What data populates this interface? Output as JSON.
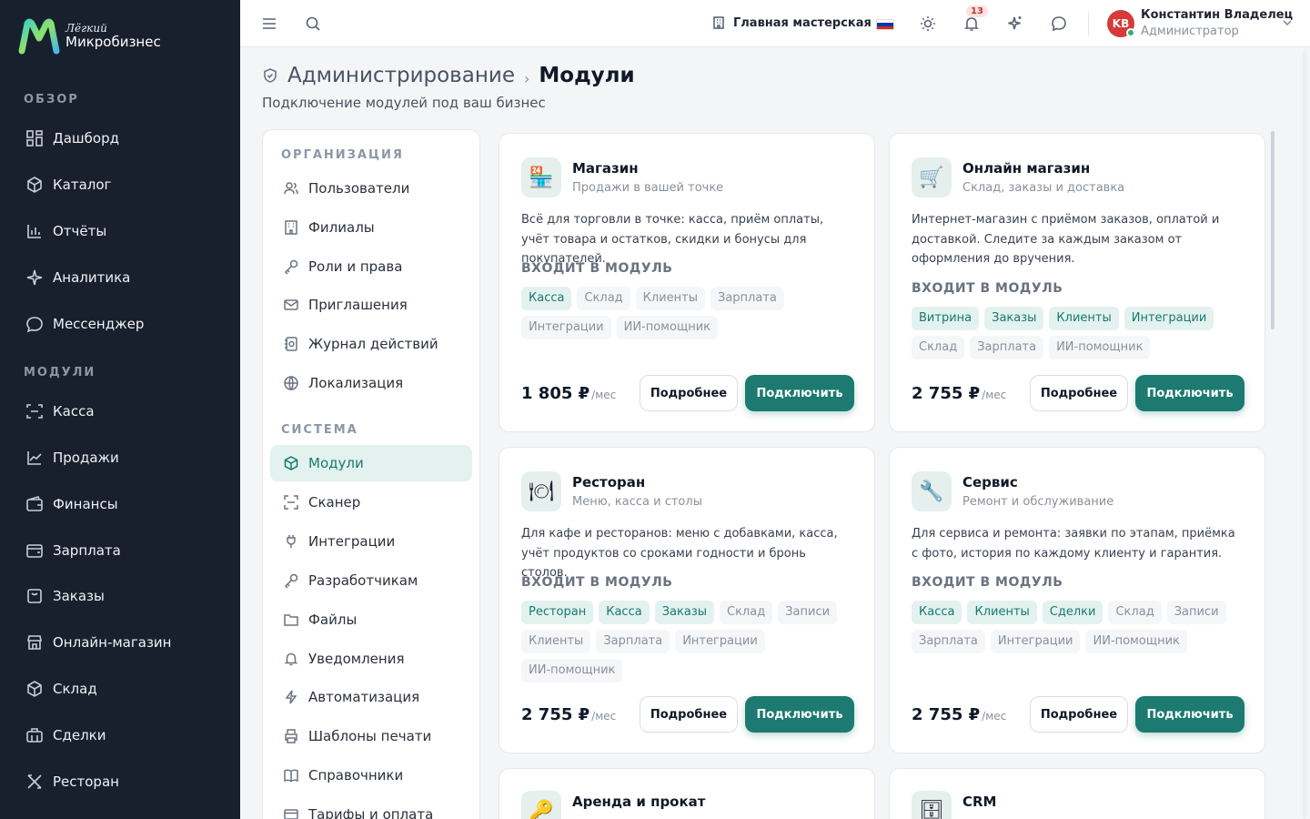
{
  "brand": {
    "sub": "Лёгкий",
    "title": "Микробизнес"
  },
  "sidebar": {
    "section_overview": "ОБЗОР",
    "overview": [
      {
        "label": "Дашборд",
        "icon": "dashboard-icon"
      },
      {
        "label": "Каталог",
        "icon": "catalog-icon"
      },
      {
        "label": "Отчёты",
        "icon": "reports-icon"
      },
      {
        "label": "Аналитика",
        "icon": "analytics-icon"
      },
      {
        "label": "Мессенджер",
        "icon": "messenger-icon"
      }
    ],
    "section_modules": "МОДУЛИ",
    "modules": [
      {
        "label": "Касса",
        "icon": "cashier-icon"
      },
      {
        "label": "Продажи",
        "icon": "sales-icon"
      },
      {
        "label": "Финансы",
        "icon": "finance-icon"
      },
      {
        "label": "Зарплата",
        "icon": "salary-icon"
      },
      {
        "label": "Заказы",
        "icon": "orders-icon"
      },
      {
        "label": "Онлайн-магазин",
        "icon": "online-store-icon"
      },
      {
        "label": "Склад",
        "icon": "warehouse-icon"
      },
      {
        "label": "Сделки",
        "icon": "deals-icon"
      },
      {
        "label": "Ресторан",
        "icon": "restaurant-icon"
      }
    ]
  },
  "topbar": {
    "workshop": "Главная мастерская",
    "notifications_count": "13",
    "user_initials": "KB",
    "user_name": "Константин Владелец",
    "user_role": "Администратор",
    "flag_colors": [
      "#ffffff",
      "#0039a6",
      "#d52b1e"
    ]
  },
  "page": {
    "crumb_root": "Администрирование",
    "crumb_sep": "›",
    "crumb_current": "Модули",
    "subtitle": "Подключение модулей под ваш бизнес"
  },
  "settings_nav": {
    "section_org": "ОРГАНИЗАЦИЯ",
    "org": [
      {
        "label": "Пользователи",
        "icon": "users-icon"
      },
      {
        "label": "Филиалы",
        "icon": "branches-icon"
      },
      {
        "label": "Роли и права",
        "icon": "key-icon"
      },
      {
        "label": "Приглашения",
        "icon": "mail-icon"
      },
      {
        "label": "Журнал действий",
        "icon": "journal-icon"
      },
      {
        "label": "Локализация",
        "icon": "globe-icon"
      }
    ],
    "section_system": "СИСТЕМА",
    "system": [
      {
        "label": "Модули",
        "icon": "module-icon",
        "active": true
      },
      {
        "label": "Сканер",
        "icon": "scanner-icon"
      },
      {
        "label": "Интеграции",
        "icon": "plug-icon"
      },
      {
        "label": "Разработчикам",
        "icon": "key-icon"
      },
      {
        "label": "Файлы",
        "icon": "folder-icon"
      },
      {
        "label": "Уведомления",
        "icon": "bell-icon"
      },
      {
        "label": "Автоматизация",
        "icon": "bolt-icon"
      },
      {
        "label": "Шаблоны печати",
        "icon": "printer-icon"
      },
      {
        "label": "Справочники",
        "icon": "book-icon"
      },
      {
        "label": "Тарифы и оплата",
        "icon": "card-icon"
      }
    ]
  },
  "cards_common": {
    "includes_label": "ВХОДИТ В МОДУЛЬ",
    "more_label": "Подробнее",
    "connect_label": "Подключить",
    "per_month": "/мес"
  },
  "cards": [
    {
      "icon": "🏪",
      "icon_name": "store-icon",
      "title": "Магазин",
      "subtitle": "Продажи в вашей точке",
      "description": "Всё для торговли в точке: касса, приём оплаты, учёт товара и остатков, скидки и бонусы для покупателей.",
      "price": "1 805 ₽",
      "tags_on": [
        "Касса"
      ],
      "tags_off": [
        "Склад",
        "Клиенты",
        "Зарплата",
        "Интеграции",
        "ИИ-помощник"
      ]
    },
    {
      "icon": "🛒",
      "icon_name": "cart-icon",
      "title": "Онлайн магазин",
      "subtitle": "Склад, заказы и доставка",
      "description": "Интернет-магазин с приёмом заказов, оплатой и доставкой. Следите за каждым заказом от оформления до вручения.",
      "price": "2 755 ₽",
      "tags_on": [
        "Витрина",
        "Заказы",
        "Клиенты",
        "Интеграции"
      ],
      "tags_off": [
        "Склад",
        "Зарплата",
        "ИИ-помощник"
      ]
    },
    {
      "icon": "🍽",
      "icon_name": "restaurant-plate-icon",
      "title": "Ресторан",
      "subtitle": "Меню, касса и столы",
      "description": "Для кафе и ресторанов: меню с добавками, касса, учёт продуктов со сроками годности и бронь столов.",
      "price": "2 755 ₽",
      "tags_on": [
        "Ресторан",
        "Касса",
        "Заказы"
      ],
      "tags_off": [
        "Склад",
        "Записи",
        "Клиенты",
        "Зарплата",
        "Интеграции",
        "ИИ-помощник"
      ]
    },
    {
      "icon": "🔧",
      "icon_name": "wrench-icon",
      "title": "Сервис",
      "subtitle": "Ремонт и обслуживание",
      "description": "Для сервиса и ремонта: заявки по этапам, приёмка с фото, история по каждому клиенту и гарантия.",
      "price": "2 755 ₽",
      "tags_on": [
        "Касса",
        "Клиенты",
        "Сделки"
      ],
      "tags_off": [
        "Склад",
        "Записи",
        "Зарплата",
        "Интеграции",
        "ИИ-помощник"
      ]
    },
    {
      "icon": "🔑",
      "icon_name": "rental-key-icon",
      "title": "Аренда и прокат",
      "subtitle": "",
      "description": "",
      "price": "",
      "tags_on": [],
      "tags_off": []
    },
    {
      "icon": "🗄",
      "icon_name": "crm-icon",
      "title": "CRM",
      "subtitle": "",
      "description": "",
      "price": "",
      "tags_on": [],
      "tags_off": []
    }
  ],
  "colors": {
    "accent": "#1c7a70",
    "sidebar_bg": "#18202e",
    "tag_on_bg": "#e3f2ef"
  }
}
